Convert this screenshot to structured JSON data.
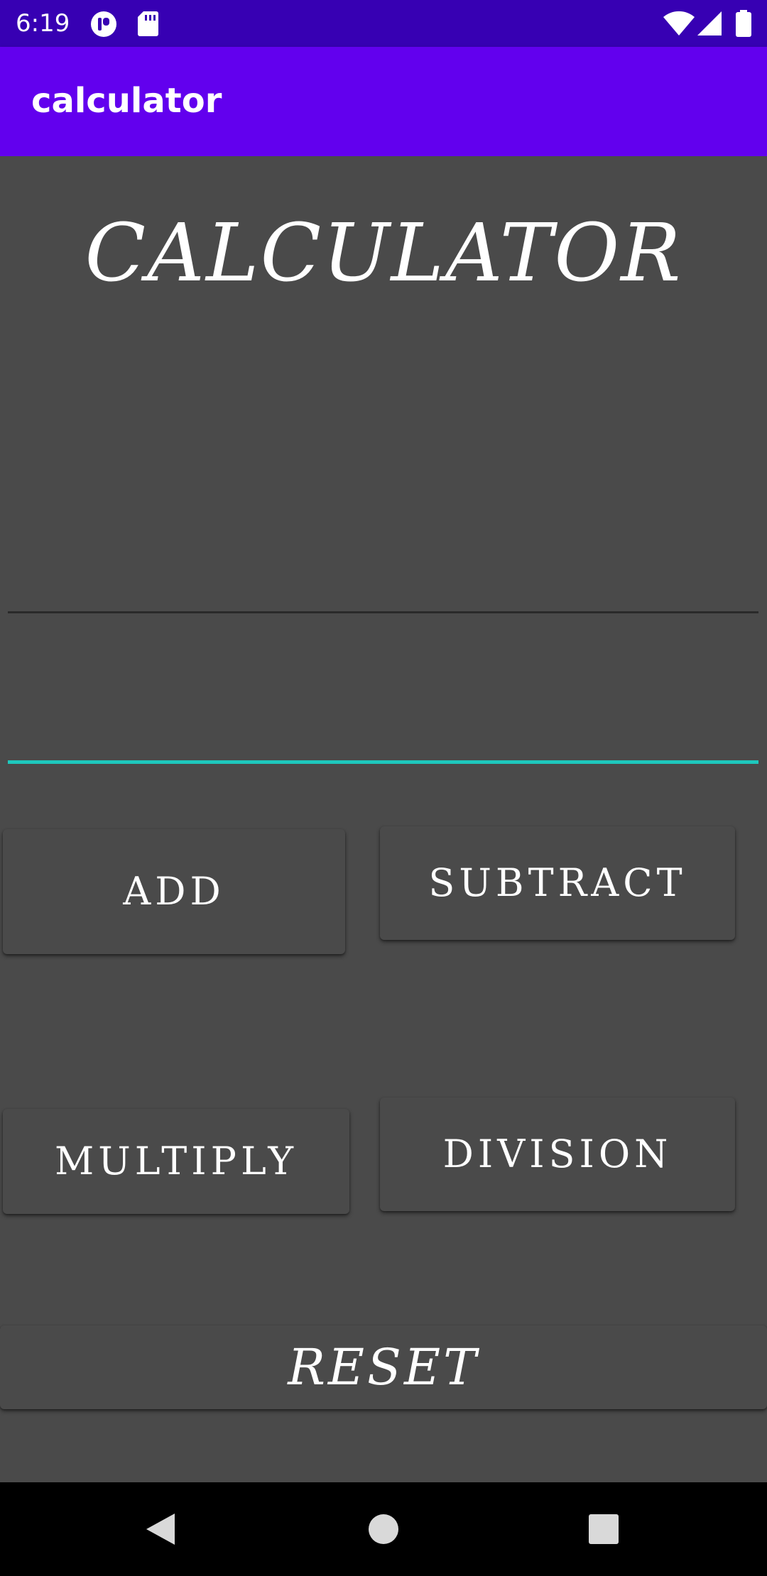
{
  "status_bar": {
    "time": "6:19",
    "icons": [
      "notification-app-icon",
      "sd-card-icon",
      "wifi-icon",
      "cell-signal-icon",
      "battery-icon"
    ]
  },
  "app_bar": {
    "title": "calculator",
    "color": "#6200ee"
  },
  "main": {
    "heading": "CALCULATOR",
    "inputs": [
      {
        "value": "",
        "placeholder": ""
      },
      {
        "value": "",
        "placeholder": ""
      }
    ],
    "buttons": {
      "add": "ADD",
      "subtract": "SUBTRACT",
      "multiply": "MULTIPLY",
      "division": "DIVISION",
      "reset": "RESET"
    },
    "accent_color": "#1ec8bd",
    "background_color": "#4a4a4a"
  },
  "nav_bar": {
    "icons": [
      "back-icon",
      "home-icon",
      "recents-icon"
    ]
  }
}
